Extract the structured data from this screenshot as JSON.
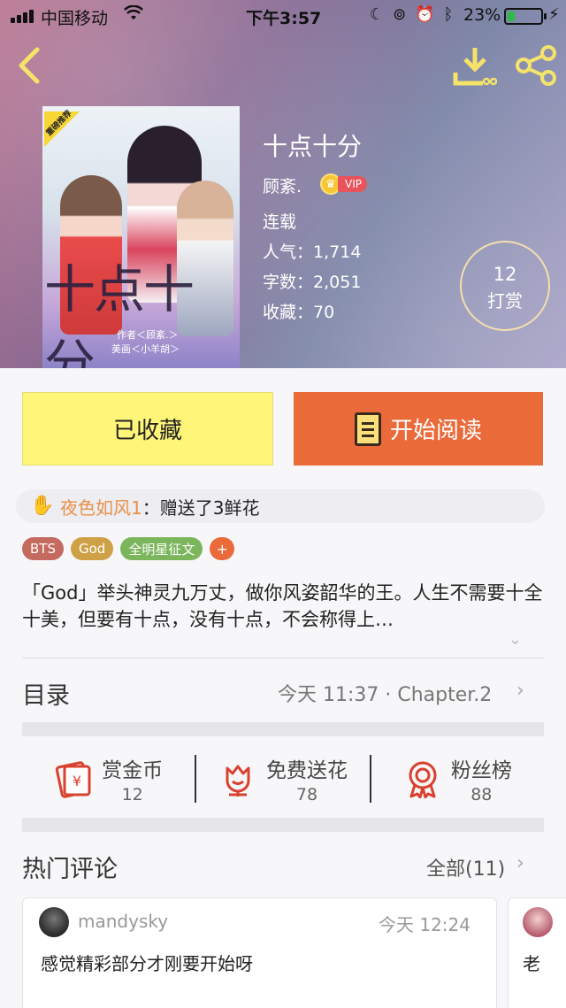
{
  "status_bar": {
    "carrier": "中国移动",
    "time": "下午3:57",
    "battery_pct": "23%",
    "battery_level": 0.23
  },
  "header": {
    "back_icon": "back-chevron-icon",
    "download_icon": "download-icon",
    "share_icon": "share-icon"
  },
  "book": {
    "title": "十点十分",
    "author": "顾紊.",
    "vip_label": "VIP",
    "status": "连载",
    "popularity_label": "人气：",
    "popularity": "1,714",
    "words_label": "字数：",
    "words": "2,051",
    "favorites_label": "收藏：",
    "favorites": "70",
    "cover": {
      "badge": "重磅推荐",
      "title": "十点十分",
      "credit_author": "作者＜顾紊.＞",
      "credit_art": "美画＜小羊胡＞"
    },
    "reward_count": "12",
    "reward_label": "打赏"
  },
  "buttons": {
    "favorited": "已收藏",
    "start_reading": "开始阅读"
  },
  "gift": {
    "user": "夜色如风1",
    "message": "：赠送了3鲜花"
  },
  "tags": [
    "BTS",
    "God",
    "全明星征文",
    "+"
  ],
  "description": "「God」举头神灵九万丈，做你风姿韶华的王。人生不需要十全十美，但要有十点，没有十点，不会称得上…",
  "toc": {
    "label": "目录",
    "latest": "今天 11:37 · Chapter.2"
  },
  "actions": [
    {
      "title": "赏金币",
      "count": "12",
      "icon": "coin-envelope-icon"
    },
    {
      "title": "免费送花",
      "count": "78",
      "icon": "flower-icon"
    },
    {
      "title": "粉丝榜",
      "count": "88",
      "icon": "ribbon-badge-icon"
    }
  ],
  "comments": {
    "label": "热门评论",
    "all": "全部(11)",
    "items": [
      {
        "user": "mandysky",
        "time": "今天 12:24",
        "text": "感觉精彩部分才刚要开始呀"
      },
      {
        "user": "",
        "time": "",
        "text": "老"
      }
    ]
  },
  "colors": {
    "favorite_bg": "#fef579",
    "read_bg": "#ea6a3a",
    "accent_orange": "#e8904a",
    "icon_red": "#d9412e"
  }
}
